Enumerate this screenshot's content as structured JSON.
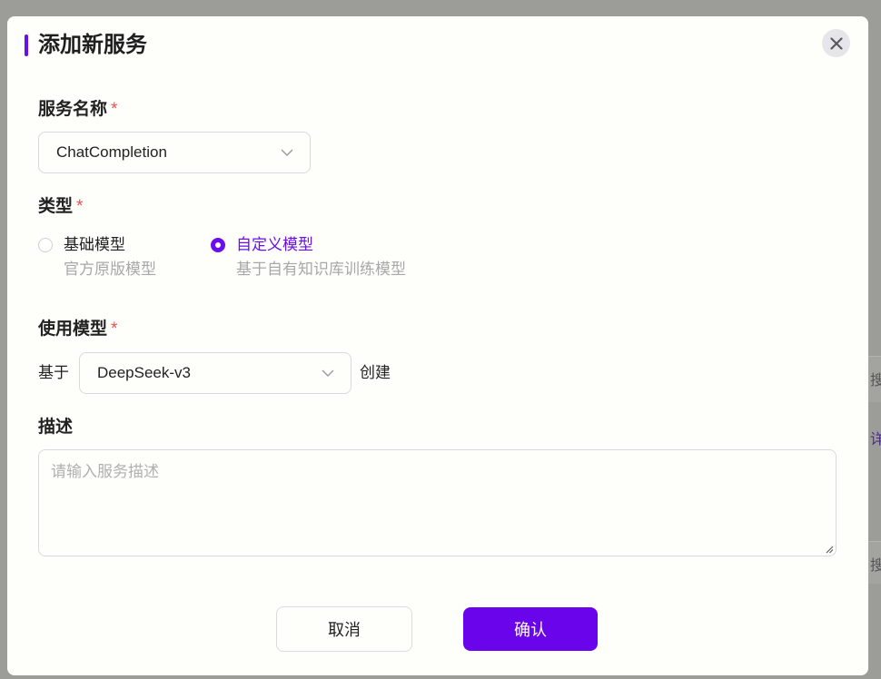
{
  "dialog": {
    "title": "添加新服务",
    "close_icon": "close-icon"
  },
  "form": {
    "service_name": {
      "label": "服务名称",
      "required_mark": "*",
      "value": "ChatCompletion",
      "icon": "chevron-down-icon"
    },
    "type": {
      "label": "类型",
      "required_mark": "*",
      "options": [
        {
          "title": "基础模型",
          "description": "官方原版模型",
          "checked": false
        },
        {
          "title": "自定义模型",
          "description": "基于自有知识库训练模型",
          "checked": true
        }
      ]
    },
    "model": {
      "label": "使用模型",
      "required_mark": "*",
      "prefix": "基于",
      "value": "DeepSeek-v3",
      "suffix": "创建",
      "icon": "chevron-down-icon"
    },
    "description": {
      "label": "描述",
      "placeholder": "请输入服务描述",
      "value": ""
    }
  },
  "footer": {
    "cancel_label": "取消",
    "confirm_label": "确认"
  },
  "colors": {
    "accent": "#6a0ef0",
    "confirm_bg": "#6a04ea",
    "required": "#f05050",
    "placeholder": "#b0b0b0"
  }
}
